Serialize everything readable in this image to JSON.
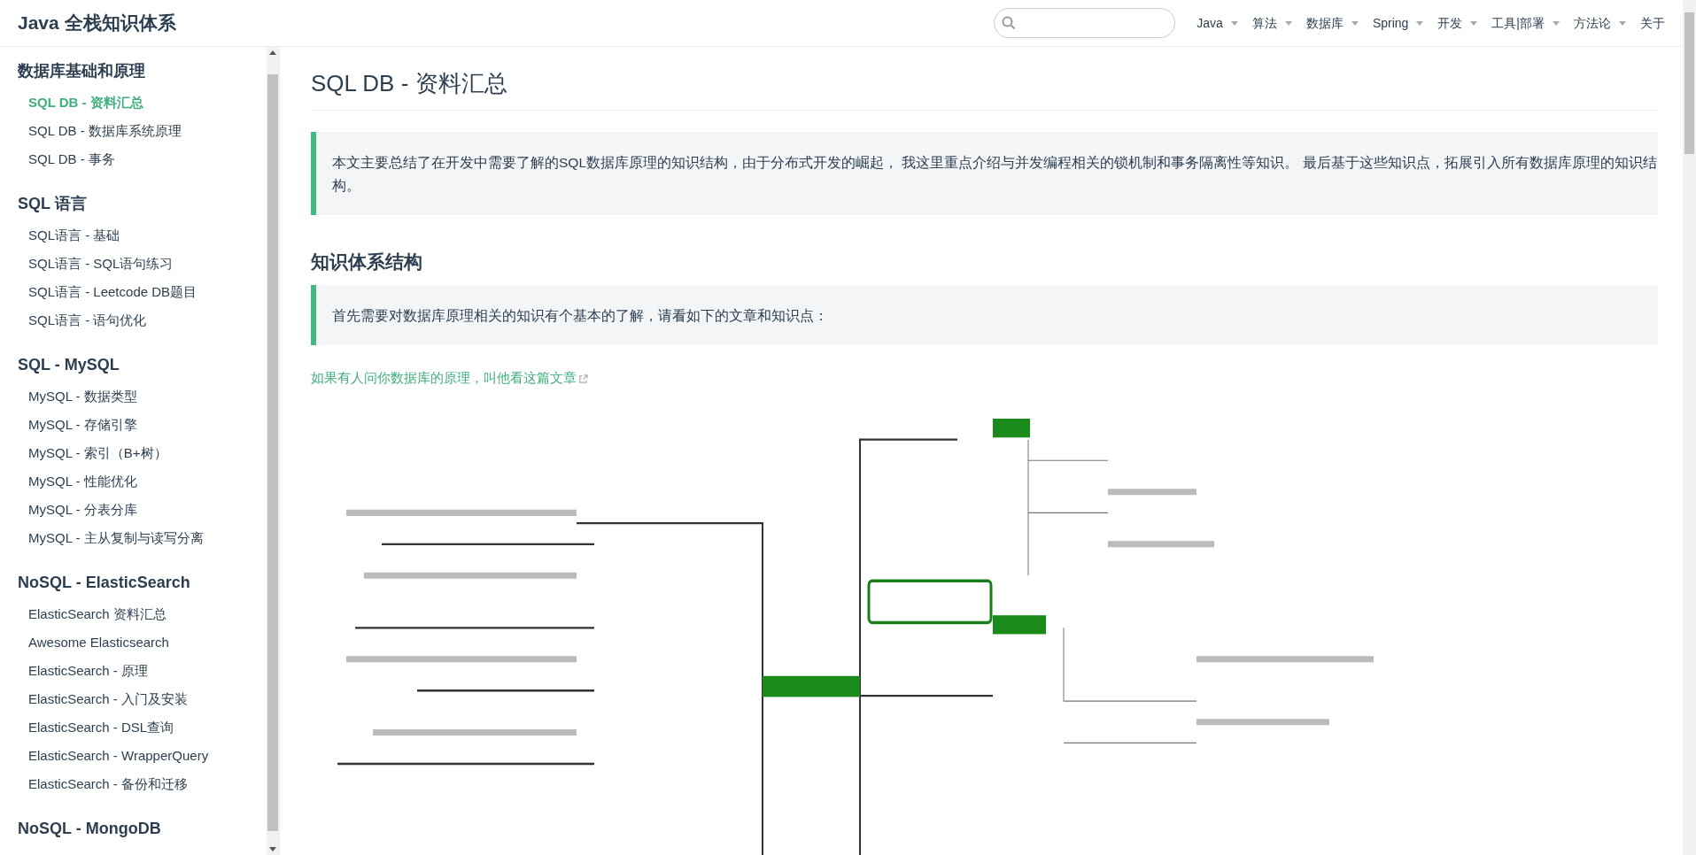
{
  "site_title": "Java 全栈知识体系",
  "nav": [
    {
      "label": "Java",
      "dropdown": true
    },
    {
      "label": "算法",
      "dropdown": true
    },
    {
      "label": "数据库",
      "dropdown": true
    },
    {
      "label": "Spring",
      "dropdown": true
    },
    {
      "label": "开发",
      "dropdown": true
    },
    {
      "label": "工具|部署",
      "dropdown": true
    },
    {
      "label": "方法论",
      "dropdown": true
    },
    {
      "label": "关于",
      "dropdown": false
    }
  ],
  "sidebar": [
    {
      "title": "数据库基础和原理",
      "items": [
        {
          "label": "SQL DB - 资料汇总",
          "selected": true
        },
        {
          "label": "SQL DB - 数据库系统原理",
          "selected": false
        },
        {
          "label": "SQL DB - 事务",
          "selected": false
        }
      ]
    },
    {
      "title": "SQL 语言",
      "items": [
        {
          "label": "SQL语言 - 基础",
          "selected": false
        },
        {
          "label": "SQL语言 - SQL语句练习",
          "selected": false
        },
        {
          "label": "SQL语言 - Leetcode DB题目",
          "selected": false
        },
        {
          "label": "SQL语言 - 语句优化",
          "selected": false
        }
      ]
    },
    {
      "title": "SQL - MySQL",
      "items": [
        {
          "label": "MySQL - 数据类型",
          "selected": false
        },
        {
          "label": "MySQL - 存储引擎",
          "selected": false
        },
        {
          "label": "MySQL - 索引（B+树）",
          "selected": false
        },
        {
          "label": "MySQL - 性能优化",
          "selected": false
        },
        {
          "label": "MySQL - 分表分库",
          "selected": false
        },
        {
          "label": "MySQL - 主从复制与读写分离",
          "selected": false
        }
      ]
    },
    {
      "title": "NoSQL - ElasticSearch",
      "items": [
        {
          "label": "ElasticSearch 资料汇总",
          "selected": false
        },
        {
          "label": "Awesome Elasticsearch",
          "selected": false
        },
        {
          "label": "ElasticSearch - 原理",
          "selected": false
        },
        {
          "label": "ElasticSearch - 入门及安装",
          "selected": false
        },
        {
          "label": "ElasticSearch - DSL查询",
          "selected": false
        },
        {
          "label": "ElasticSearch - WrapperQuery",
          "selected": false
        },
        {
          "label": "ElasticSearch - 备份和迁移",
          "selected": false
        }
      ]
    },
    {
      "title": "NoSQL - MongoDB"
    }
  ],
  "article": {
    "title": "SQL DB - 资料汇总",
    "intro": "本文主要总结了在开发中需要了解的SQL数据库原理的知识结构，由于分布式开发的崛起， 我这里重点介绍与并发编程相关的锁机制和事务隔离性等知识。 最后基于这些知识点，拓展引入所有数据库原理的知识结构。",
    "section_title": "知识体系结构",
    "section_note": "首先需要对数据库原理相关的知识有个基本的了解，请看如下的文章和知识点：",
    "link": {
      "label": "如果有人问你数据库的原理，叫他看这篇文章",
      "external": true
    }
  }
}
